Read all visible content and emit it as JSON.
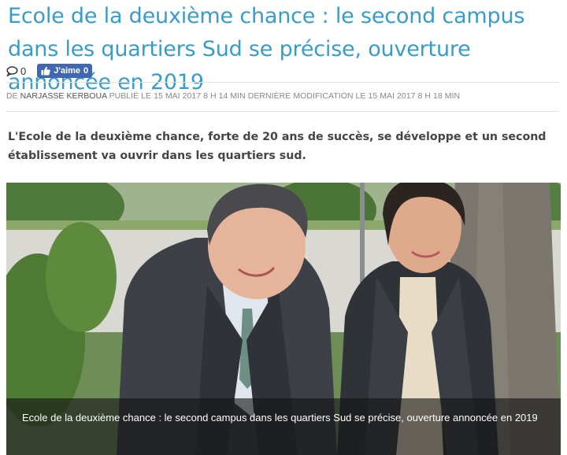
{
  "article": {
    "title": "Ecole de la deuxième chance : le second campus dans les quartiers Sud se précise, ouverture annoncée en 2019",
    "comment_count": "0",
    "fb_like_label": "J'aime",
    "fb_like_count": "0",
    "meta": {
      "by_label": "DE",
      "author": "NARJASSE KERBOUA",
      "published_label": "PUBLIÉ LE",
      "published": "15 MAI 2017 8 H 14 MIN",
      "modified_label": "DERNIÈRE MODIFICATION LE",
      "modified": "15 MAI 2017 8 H 18 MIN"
    },
    "lead": "L'Ecole de la deuxième chance, forte de 20 ans de succès, se développe et un second établissement va ouvrir dans les quartiers sud.",
    "photo_caption": "Ecole de la deuxième chance : le second campus dans les quartiers Sud se précise, ouverture annoncée en 2019"
  },
  "colors": {
    "title": "#3a9bc7",
    "facebook": "#4267b2"
  }
}
